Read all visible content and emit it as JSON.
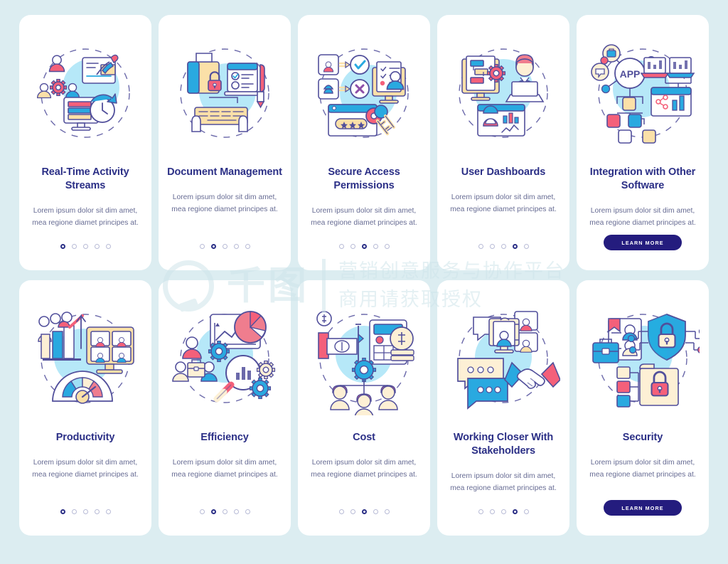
{
  "palette": {
    "page_background": "#dcedf1",
    "card_background": "#ffffff",
    "title_color": "#2b2f86",
    "body_color": "#5a5f8a",
    "button_color": "#241c7e",
    "accent_blue": "#29a9e0",
    "accent_light_blue": "#9fe0f5",
    "accent_pink": "#f4607a",
    "accent_yellow": "#fbdFA8",
    "outline": "#514f9b"
  },
  "watermark": {
    "line1": "营销创意服务与协作平台",
    "line2": "商用请获取授权",
    "logo_text": "千图",
    "logo_name": "qiantu-logo"
  },
  "shared": {
    "description": "Lorem ipsum dolor sit dim amet, mea regione diamet principes at.",
    "learn_more_label": "LEARN MORE",
    "dot_count": 5
  },
  "cards": [
    {
      "id": "real-time-activity-streams",
      "title": "Real-Time Activity Streams",
      "description": "Lorem ipsum dolor sit dim amet, mea regione diamet principes at.",
      "active_dot": 1,
      "has_button": false,
      "illustration": "users-gear-document-clock-monitor"
    },
    {
      "id": "document-management",
      "title": "Document Management",
      "description": "Lorem ipsum dolor sit dim amet, mea regione diamet principes at.",
      "active_dot": 2,
      "has_button": false,
      "illustration": "folder-lock-checklist-keyboard-hands"
    },
    {
      "id": "secure-access-permissions",
      "title": "Secure Access Permissions",
      "description": "Lorem ipsum dolor sit dim amet, mea regione diamet principes at.",
      "active_dot": 3,
      "has_button": false,
      "illustration": "user-check-cross-password-keys"
    },
    {
      "id": "user-dashboards",
      "title": "User Dashboards",
      "description": "Lorem ipsum dolor sit dim amet, mea regione diamet principes at.",
      "active_dot": 4,
      "has_button": false,
      "illustration": "monitor-gear-person-laptop-charts"
    },
    {
      "id": "integration-with-other-software",
      "title": "Integration with Other Software",
      "description": "Lorem ipsum dolor sit dim amet, mea regione diamet principes at.",
      "active_dot": 0,
      "has_button": true,
      "button_label": "LEARN MORE",
      "illustration": "app-node-network-laptops-analytics"
    },
    {
      "id": "productivity",
      "title": "Productivity",
      "description": "Lorem ipsum dolor sit dim amet, mea regione diamet principes at.",
      "active_dot": 1,
      "has_button": false,
      "illustration": "people-bar-chart-video-grid-gauge"
    },
    {
      "id": "efficiency",
      "title": "Efficiency",
      "description": "Lorem ipsum dolor sit dim amet, mea regione diamet principes at.",
      "active_dot": 2,
      "has_button": false,
      "illustration": "graph-pie-clock-team-magnifier-gears"
    },
    {
      "id": "cost",
      "title": "Cost",
      "description": "Lorem ipsum dolor sit dim amet, mea regione diamet principes at.",
      "active_dot": 3,
      "has_button": false,
      "illustration": "money-calculator-coins-gear-team"
    },
    {
      "id": "working-closer-with-stakeholders",
      "title": "Working Closer With Stakeholders",
      "description": "Lorem ipsum dolor sit dim amet, mea regione diamet principes at.",
      "active_dot": 4,
      "has_button": false,
      "illustration": "video-call-chat-bubbles-handshake"
    },
    {
      "id": "security",
      "title": "Security",
      "description": "Lorem ipsum dolor sit dim amet, mea regione diamet principes at.",
      "active_dot": 0,
      "has_button": true,
      "button_label": "LEARN MORE",
      "illustration": "id-card-briefcase-shield-lock-folder"
    }
  ]
}
